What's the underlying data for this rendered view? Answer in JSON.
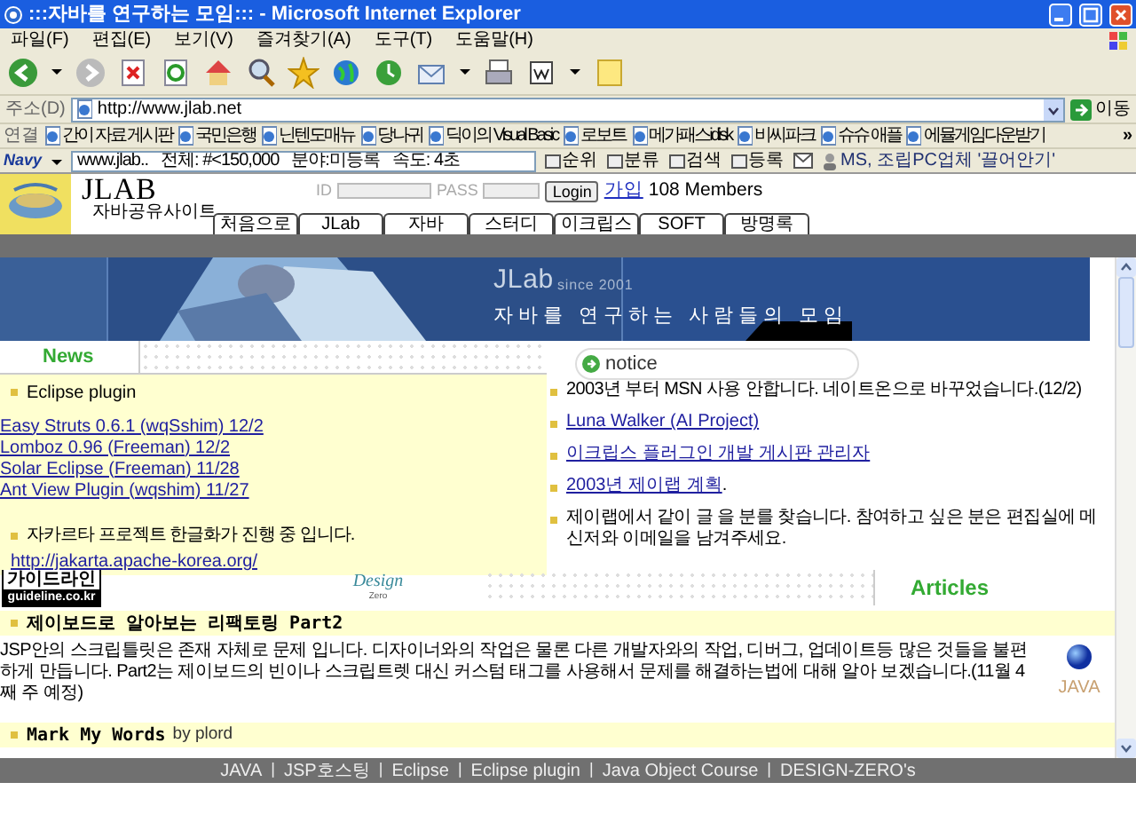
{
  "window": {
    "title": ":::자바를 연구하는 모임::: - Microsoft Internet Explorer"
  },
  "menu": [
    "파일(F)",
    "편집(E)",
    "보기(V)",
    "즐겨찾기(A)",
    "도구(T)",
    "도움말(H)"
  ],
  "address": {
    "label": "주소(D)",
    "url": "http://www.jlab.net",
    "go": "이동"
  },
  "links": {
    "label": "연결",
    "items": [
      "간이 자료 게시판",
      "국민은행",
      "닌텐도매뉴",
      "당나귀",
      "딕이의 Visual Basic",
      "로보트",
      "메가패스idisk",
      "비씨파크",
      "슈슈 애플",
      "에뮬게임다운받기"
    ],
    "more": "»"
  },
  "navy": {
    "brand": "Navy",
    "info": "www.jlab..",
    "total": "전체: #<150,000",
    "field": "분야:미등록",
    "speed": "속도: 4초",
    "buttons": [
      "순위",
      "분류",
      "검색",
      "등록"
    ],
    "ticker": "MS, 조립PC업체 '끌어안기'"
  },
  "site": {
    "logo": "JLAB",
    "tagline": "자바공유사이트",
    "id_label": "ID",
    "pass_label": "PASS",
    "login": "Login",
    "join": "가입",
    "members": "108 Members",
    "tabs": [
      "처음으로",
      "JLab",
      "자바",
      "스터디",
      "이크립스",
      "SOFT",
      "방명록"
    ]
  },
  "banner": {
    "title": "JLab",
    "since": "since 2001",
    "subtitle": "자바를 연구하는 사람들의 모임"
  },
  "news": {
    "heading": "News",
    "items": [
      {
        "kind": "bullet",
        "text": "Eclipse plugin"
      },
      {
        "kind": "link",
        "text": "Easy Struts 0.6.1 (wqSshim) 12/2"
      },
      {
        "kind": "link",
        "text": "Lomboz 0.96 (Freeman) 12/2"
      },
      {
        "kind": "link",
        "text": "Solar Eclipse (Freeman) 11/28"
      },
      {
        "kind": "link",
        "text": "Ant View Plugin  (wqshim) 11/27"
      },
      {
        "kind": "bullet_link",
        "text": "자카르타 프로젝트 한글화가 진행 중 입니다.",
        "link": "http://jakarta.apache-korea.org/"
      }
    ]
  },
  "notice": {
    "heading": "notice",
    "items": [
      {
        "kind": "text",
        "text": "2003년 부터 MSN 사용 안합니다. 네이트온으로 바꾸었습니다.(12/2)"
      },
      {
        "kind": "link",
        "text": "Luna Walker (AI Project)"
      },
      {
        "kind": "link",
        "text": "이크립스 플러그인 개발 게시판 관리자"
      },
      {
        "kind": "link",
        "text": "2003년 제이랩 계획",
        "suffix": "."
      },
      {
        "kind": "text",
        "text": "제이랩에서 같이 글 을 분를 찾습니다. 참여하고 싶은 분은 편집실에 메신저와 이메일을 남겨주세요."
      }
    ]
  },
  "partners": {
    "guideline": "가이드라인",
    "guideline_url": "guideline.co.kr",
    "design": "Design",
    "design_sub": "Zero"
  },
  "articles": {
    "heading": "Articles",
    "items": [
      {
        "title": "제이보드로 알아보는 리팩토링 Part2",
        "body": "JSP안의 스크립틀릿은 존재 자체로 문제 입니다. 디자이너와의 작업은 물론 다른 개발자와의 작업, 디버그, 업데이트등 많은 것들을 불편하게 만듭니다. Part2는 제이보드의 빈이나 스크립트렛 대신 커스텀 태그를 사용해서 문제를 해결하는법에 대해 알아 보겠습니다.(11월 4째 주 예정)",
        "tag": "JAVA"
      },
      {
        "title": "Mark My Words",
        "author": "by plord"
      }
    ]
  },
  "footer": {
    "links": [
      "JAVA",
      "JSP호스팅",
      "Eclipse",
      "Eclipse plugin",
      "Java Object Course",
      "DESIGN-ZERO's"
    ],
    "separator": "|"
  }
}
